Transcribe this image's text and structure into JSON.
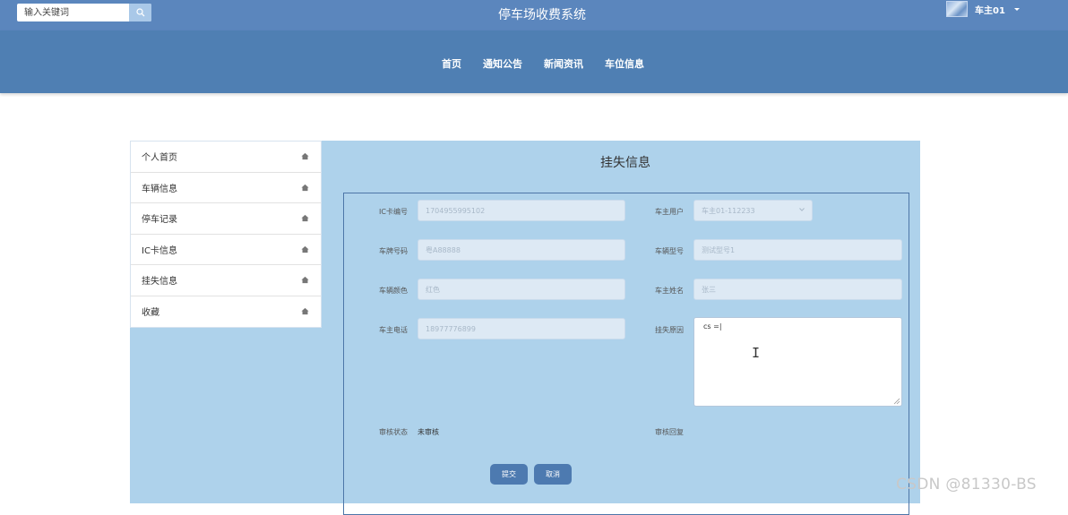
{
  "header": {
    "search_placeholder": "输入关键词",
    "site_title": "停车场收费系统",
    "user_name": "车主01"
  },
  "nav": {
    "items": [
      "首页",
      "通知公告",
      "新闻资讯",
      "车位信息"
    ]
  },
  "sidebar": {
    "items": [
      "个人首页",
      "车辆信息",
      "停车记录",
      "IC卡信息",
      "挂失信息",
      "收藏"
    ]
  },
  "panel": {
    "title": "挂失信息",
    "fields": {
      "ic_card_label": "IC卡编号",
      "ic_card_value": "1704955995102",
      "owner_user_label": "车主用户",
      "owner_user_value": "车主01-112233",
      "plate_label": "车牌号码",
      "plate_value": "粤A88888",
      "model_label": "车辆型号",
      "model_value": "测试型号1",
      "color_label": "车辆颜色",
      "color_value": "红色",
      "owner_name_label": "车主姓名",
      "owner_name_value": "张三",
      "phone_label": "车主电话",
      "phone_value": "18977776899",
      "reason_label": "挂失原因",
      "reason_value": "cs =|",
      "audit_status_label": "审核状态",
      "audit_status_value": "未审核",
      "audit_reply_label": "审核回复"
    },
    "submit_label": "提交",
    "cancel_label": "取消"
  },
  "watermark": "CSDN @81330-BS",
  "colors": {
    "topbar": "#5b86bd",
    "navbar": "#4f7fb3",
    "content_bg": "#aed2eb",
    "button": "#4d7ab0"
  }
}
